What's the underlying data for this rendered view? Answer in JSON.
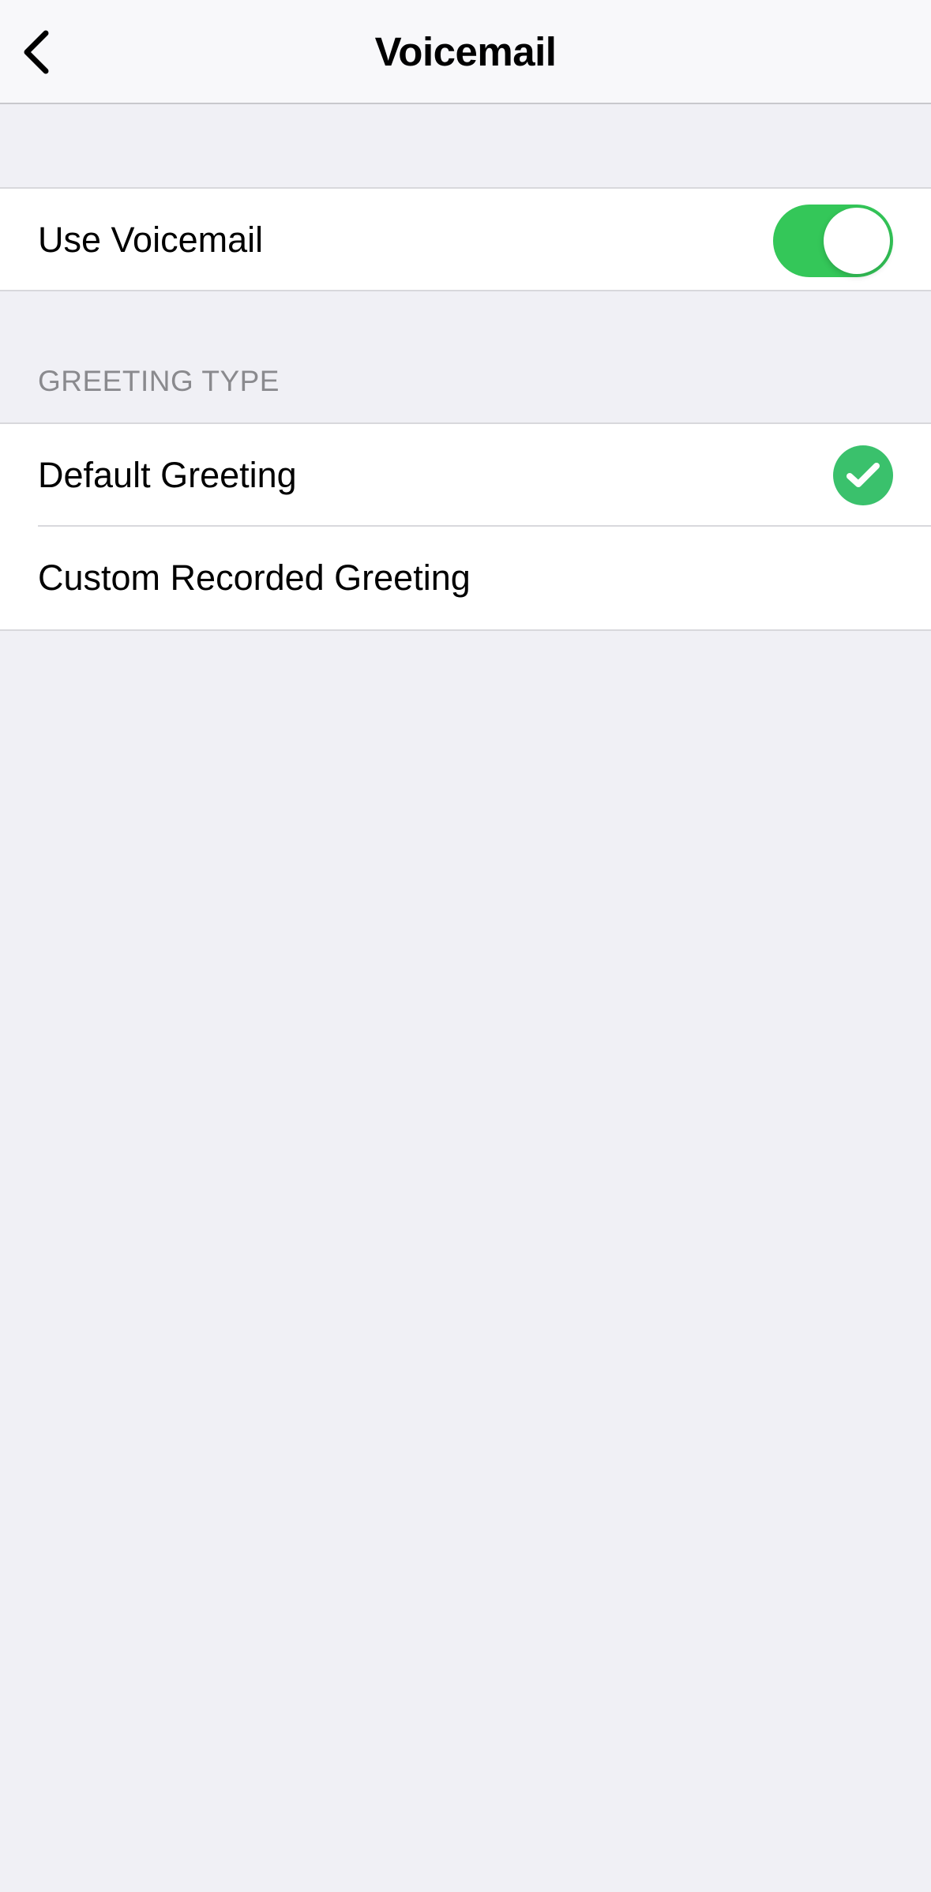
{
  "nav": {
    "title": "Voicemail",
    "back_icon": "chevron-left-icon"
  },
  "voicemail": {
    "label": "Use Voicemail",
    "enabled": true,
    "toggle_color": "#34c759"
  },
  "greeting": {
    "header": "GREETING TYPE",
    "options": [
      {
        "label": "Default Greeting",
        "selected": true
      },
      {
        "label": "Custom Recorded Greeting",
        "selected": false
      }
    ],
    "check_color": "#3ac16c",
    "check_icon": "checkmark-circle-icon"
  },
  "colors": {
    "background": "#f0f0f5",
    "text": "#000000",
    "section_header": "#8a8a8e"
  }
}
